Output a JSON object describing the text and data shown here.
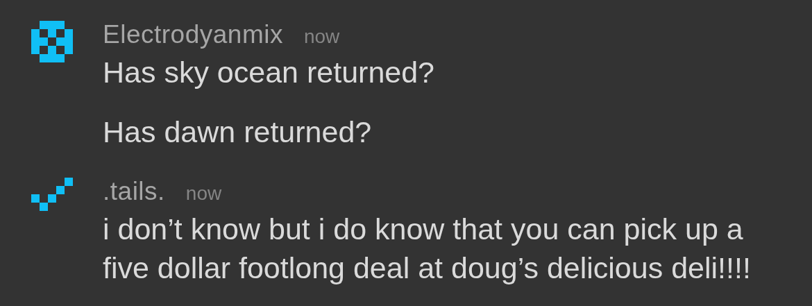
{
  "messages": [
    {
      "author": "Electrodyanmix",
      "time": "now",
      "avatar": {
        "kind": "cross"
      },
      "lines": [
        "Has sky ocean returned?",
        "Has dawn returned?"
      ]
    },
    {
      "author": ".tails.",
      "time": "now",
      "avatar": {
        "kind": "check"
      },
      "lines": [
        "i don’t know but i do know that you can pick up a five dollar footlong deal at doug’s delicious deli!!!!"
      ]
    }
  ]
}
